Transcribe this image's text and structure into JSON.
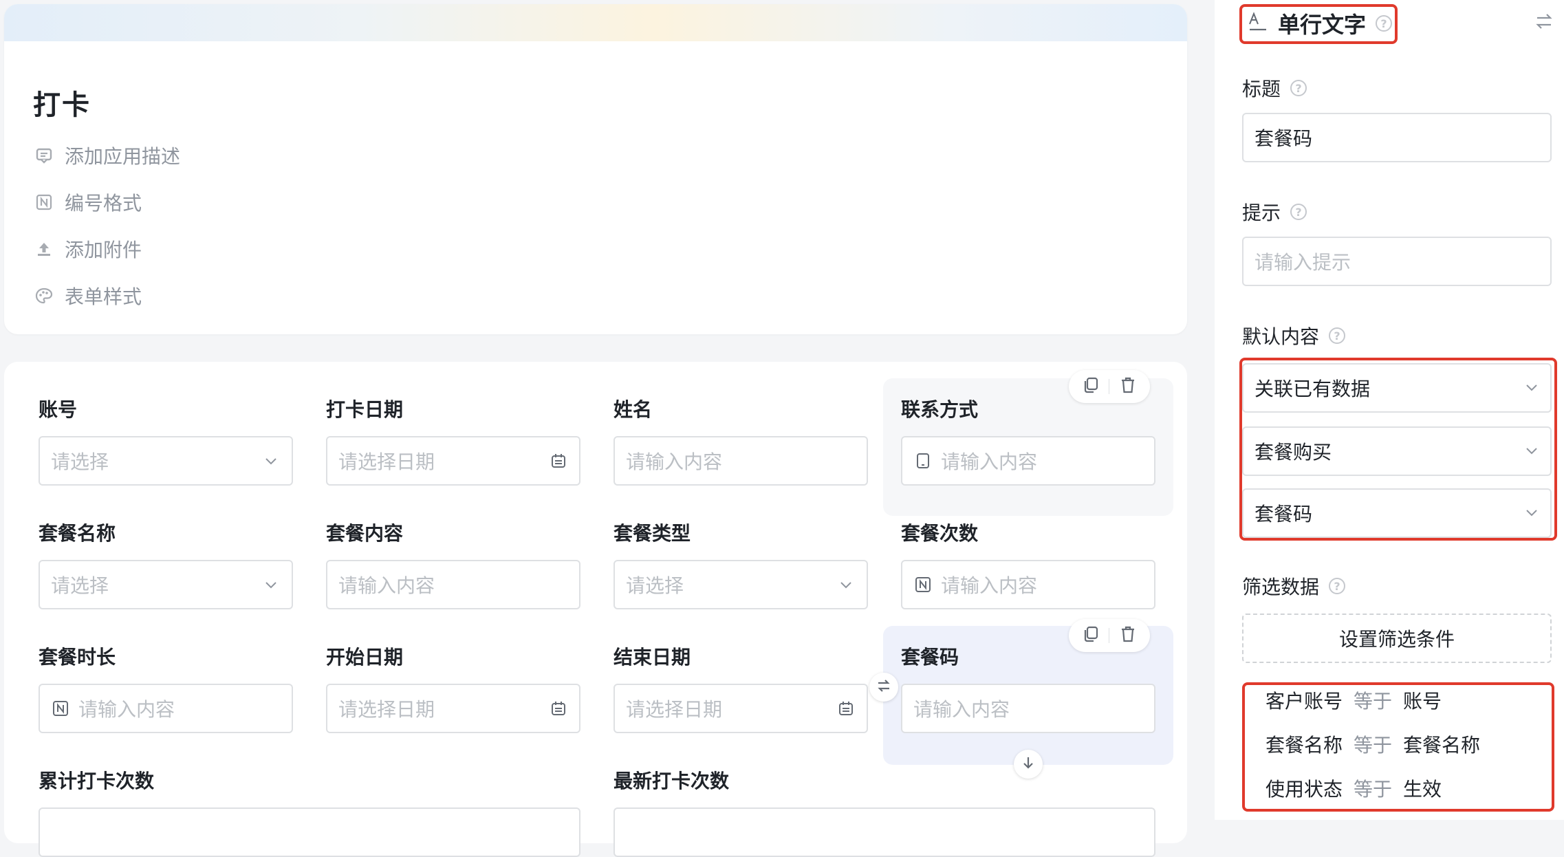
{
  "app": {
    "title": "打卡",
    "meta": [
      {
        "icon": "comment-icon",
        "label": "添加应用描述"
      },
      {
        "icon": "numbering-icon",
        "label": "编号格式"
      },
      {
        "icon": "upload-icon",
        "label": "添加附件"
      },
      {
        "icon": "palette-icon",
        "label": "表单样式"
      }
    ]
  },
  "form": {
    "fields": [
      {
        "label": "账号",
        "placeholder": "请选择",
        "kind": "select"
      },
      {
        "label": "打卡日期",
        "placeholder": "请选择日期",
        "kind": "date"
      },
      {
        "label": "姓名",
        "placeholder": "请输入内容",
        "kind": "text"
      },
      {
        "label": "联系方式",
        "placeholder": "请输入内容",
        "kind": "phone"
      },
      {
        "label": "套餐名称",
        "placeholder": "请选择",
        "kind": "select"
      },
      {
        "label": "套餐内容",
        "placeholder": "请输入内容",
        "kind": "text"
      },
      {
        "label": "套餐类型",
        "placeholder": "请选择",
        "kind": "select"
      },
      {
        "label": "套餐次数",
        "placeholder": "请输入内容",
        "kind": "number"
      },
      {
        "label": "套餐时长",
        "placeholder": "请输入内容",
        "kind": "number"
      },
      {
        "label": "开始日期",
        "placeholder": "请选择日期",
        "kind": "date"
      },
      {
        "label": "结束日期",
        "placeholder": "请选择日期",
        "kind": "date"
      },
      {
        "label": "套餐码",
        "placeholder": "请输入内容",
        "kind": "text"
      },
      {
        "label": "累计打卡次数"
      },
      {
        "label": "最新打卡次数"
      }
    ]
  },
  "panel": {
    "field_type": "单行文字",
    "title_label": "标题",
    "title_value": "套餐码",
    "hint_label": "提示",
    "hint_placeholder": "请输入提示",
    "default_label": "默认内容",
    "default_mode": "关联已有数据",
    "default_form": "套餐购买",
    "default_field": "套餐码",
    "filter_label": "筛选数据",
    "filter_button": "设置筛选条件",
    "conditions": [
      {
        "field": "客户账号",
        "op": "等于",
        "value": "账号"
      },
      {
        "field": "套餐名称",
        "op": "等于",
        "value": "套餐名称"
      },
      {
        "field": "使用状态",
        "op": "等于",
        "value": "生效"
      }
    ]
  },
  "colors": {
    "highlight": "#e03a2c",
    "selected_bg": "#eef1fb",
    "hover_bg": "#f6f7f9"
  }
}
